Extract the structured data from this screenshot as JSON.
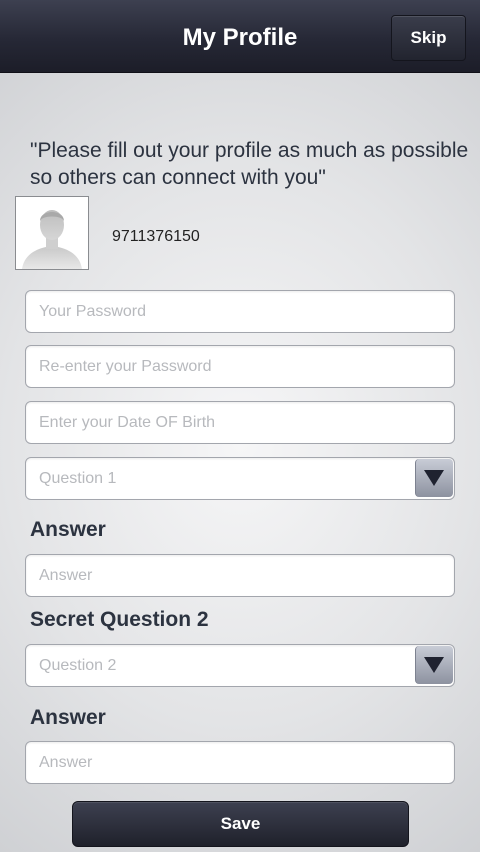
{
  "header": {
    "title": "My Profile",
    "skip_label": "Skip"
  },
  "intro": {
    "quote": "\"Please fill out your profile as much as possible so others can connect with you\""
  },
  "profile": {
    "avatar_icon": "user-silhouette-icon",
    "phone": "9711376150"
  },
  "form": {
    "password_placeholder": "Your Password",
    "reenter_password_placeholder": "Re-enter your Password",
    "dob_placeholder": "Enter your Date OF Birth",
    "question1_value": "Question 1",
    "answer1_label": "Answer",
    "answer1_placeholder": "Answer",
    "secret_question2_label": "Secret Question 2",
    "question2_value": "Question 2",
    "answer2_label": "Answer",
    "answer2_placeholder": "Answer"
  },
  "footer": {
    "save_label": "Save"
  },
  "colors": {
    "navbar": "#262836",
    "heading_text": "#2c3340",
    "placeholder": "#b7b9bd"
  }
}
